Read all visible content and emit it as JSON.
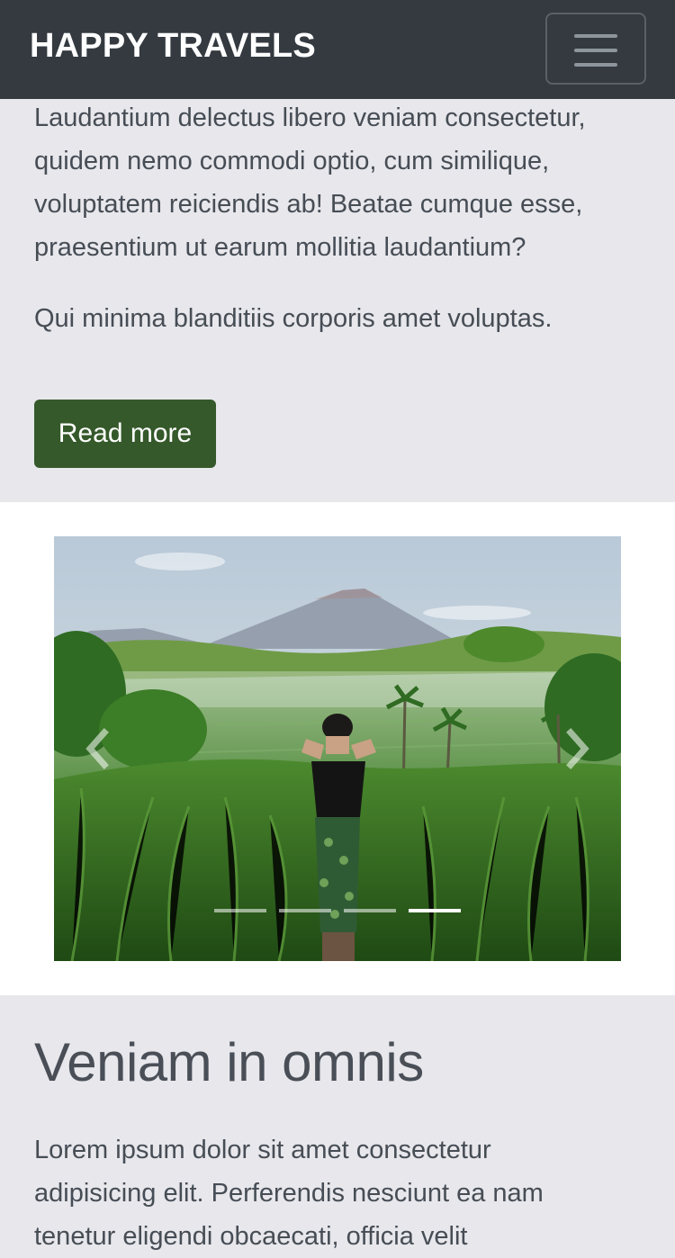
{
  "navbar": {
    "brand": "HAPPY TRAVELS",
    "toggle_icon": "hamburger-menu-icon"
  },
  "intro": {
    "paragraph1": "Laudantium delectus libero veniam consectetur, quidem nemo commodi optio, cum similique, voluptatem reiciendis ab! Beatae cumque esse, praesentium ut earum mollitia laudantium?",
    "paragraph2": "Qui minima blanditiis corporis amet voluptas.",
    "read_more_label": "Read more",
    "button_color": "#35592a"
  },
  "carousel": {
    "prev_icon": "chevron-left-icon",
    "next_icon": "chevron-right-icon",
    "slide_count": 4,
    "active_index": 3,
    "image_alt": "Woman in field looking at mountain and rice terraces"
  },
  "section": {
    "heading": "Veniam in omnis",
    "body": "Lorem ipsum dolor sit amet consectetur adipisicing elit. Perferendis nesciunt ea nam tenetur eligendi obcaecati, officia velit"
  }
}
